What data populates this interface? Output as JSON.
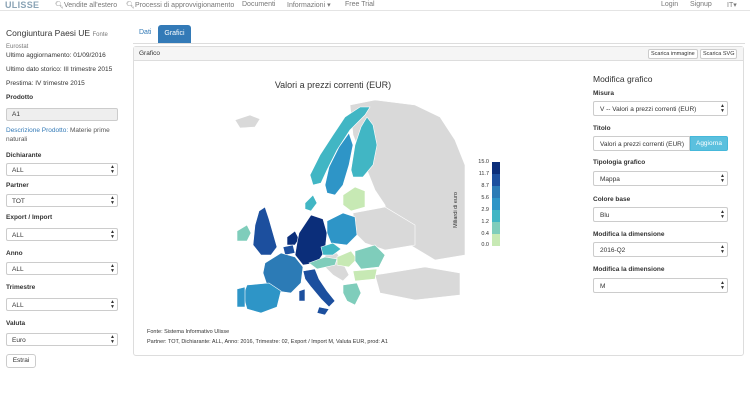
{
  "nav": {
    "logo": "ULISSE",
    "items": [
      {
        "label": "Vendite all'estero",
        "icon": "search-icon"
      },
      {
        "label": "Processi di approvvigionamento",
        "icon": "search-icon"
      },
      {
        "label": "Documenti"
      },
      {
        "label": "Informazioni ▾"
      },
      {
        "label": "Free Trial"
      }
    ],
    "login": "Login",
    "signup": "Signup",
    "lang": "IT▾"
  },
  "sidebar": {
    "title": "Congiuntura Paesi UE",
    "fonte_label": "Fonte",
    "fonte_value": "Eurostat",
    "ultimo_aggiornamento": "Ultimo aggiornamento: 01/09/2016",
    "ultimo_dato": "Ultimo dato storico: III trimestre 2015",
    "prestima": "Prestima: IV trimestre 2015",
    "prodotto_label": "Prodotto",
    "prodotto_value": "A1",
    "descrizione_label": "Descrizione Prodotto:",
    "descrizione_value": "Materie prime naturali",
    "dichiarante_label": "Dichiarante",
    "dichiarante_value": "ALL",
    "partner_label": "Partner",
    "partner_value": "TOT",
    "export_label": "Export / Import",
    "export_value": "ALL",
    "anno_label": "Anno",
    "anno_value": "ALL",
    "trimestre_label": "Trimestre",
    "trimestre_value": "ALL",
    "valuta_label": "Valuta",
    "valuta_value": "Euro",
    "estrai": "Estrai"
  },
  "tabs": {
    "dati": "Dati",
    "grafici": "Grafici"
  },
  "panel": {
    "heading": "Grafico",
    "scarica_immagine": "Scarica immagine",
    "scarica_svg": "Scarica SVG"
  },
  "chart_data": {
    "type": "map",
    "title": "Valori a prezzi correnti (EUR)",
    "legend_title": "Miliardi di euro",
    "legend_ticks": [
      "15.0",
      "11.7",
      "8.7",
      "5.6",
      "2.9",
      "1.2",
      "0.4",
      "0.0"
    ],
    "colors": [
      "#0b2e7a",
      "#1c4f9e",
      "#2c7bb6",
      "#2e95c7",
      "#41b6c4",
      "#7fcdbb",
      "#c7e9b4"
    ],
    "regions": [
      {
        "name": "Germany",
        "level": 0
      },
      {
        "name": "France",
        "level": 2
      },
      {
        "name": "Italy",
        "level": 1
      },
      {
        "name": "Spain",
        "level": 3
      },
      {
        "name": "United Kingdom",
        "level": 3
      },
      {
        "name": "Netherlands",
        "level": 0
      },
      {
        "name": "Belgium",
        "level": 1
      },
      {
        "name": "Poland",
        "level": 4
      },
      {
        "name": "Sweden",
        "level": 4
      },
      {
        "name": "Finland",
        "level": 4
      },
      {
        "name": "Norway",
        "level": 4
      },
      {
        "name": "Portugal",
        "level": 4
      },
      {
        "name": "Ireland",
        "level": 5
      },
      {
        "name": "Austria",
        "level": 5
      },
      {
        "name": "Czech Republic",
        "level": 4
      },
      {
        "name": "Denmark",
        "level": 4
      },
      {
        "name": "Romania",
        "level": 5
      },
      {
        "name": "Hungary",
        "level": 6
      },
      {
        "name": "Greece",
        "level": 5
      },
      {
        "name": "Baltics",
        "level": 6
      },
      {
        "name": "Bulgaria",
        "level": 6
      }
    ]
  },
  "footnote": {
    "line1": "Fonte: Sistema Informativo Ulisse",
    "line2": "Partner: TOT, Dichiarante: ALL, Anno: 2016, Trimestre: 02, Export / Import M, Valuta EUR, prod: A1"
  },
  "form": {
    "title": "Modifica grafico",
    "misura_label": "Misura",
    "misura_value": "V -- Valori a prezzi correnti (EUR)",
    "titolo_label": "Titolo",
    "titolo_value": "Valori a prezzi correnti (EUR)",
    "aggiorna": "Aggiorna",
    "tipologia_label": "Tipologia grafico",
    "tipologia_value": "Mappa",
    "colore_label": "Colore base",
    "colore_value": "Blu",
    "dim1_label": "Modifica la dimensione",
    "dim1_value": "2016-Q2",
    "dim2_label": "Modifica la dimensione",
    "dim2_value": "M"
  }
}
